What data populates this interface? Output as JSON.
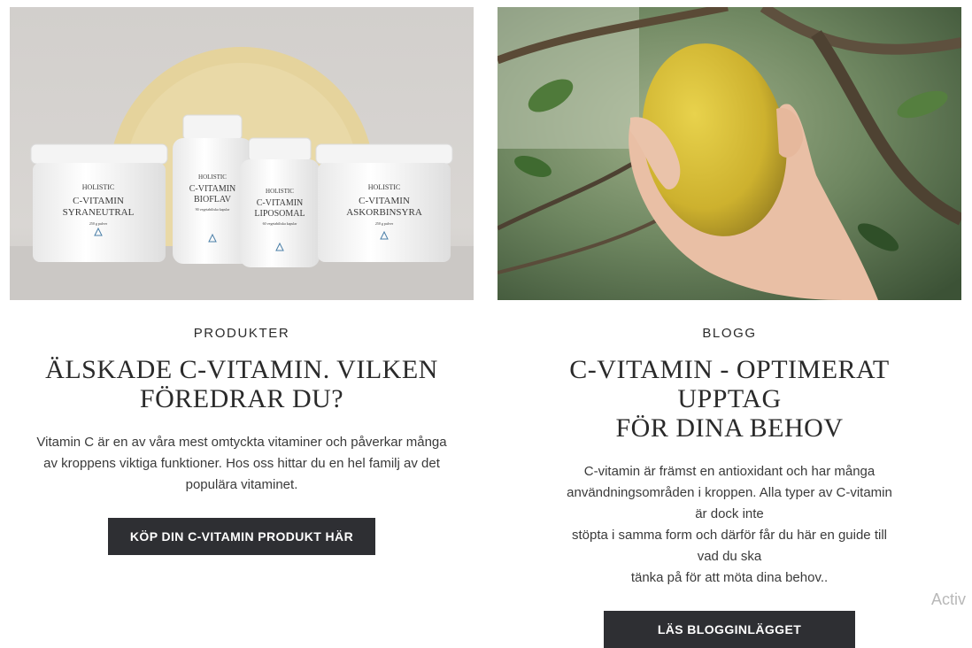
{
  "products_card": {
    "image": {
      "alt_icon": "vitamin-c-products-image",
      "jars": [
        {
          "brand": "HOLISTIC",
          "line1": "C-VITAMIN",
          "line2": "SYRANEUTRAL",
          "sub": "250 g pulver"
        },
        {
          "brand": "HOLISTIC",
          "line1": "C-VITAMIN",
          "line2": "BIOFLAV",
          "sub": "90 vegetabiliska kapslar"
        },
        {
          "brand": "HOLISTIC",
          "line1": "C-VITAMIN",
          "line2": "LIPOSOMAL",
          "sub": "60 vegetabiliska kapslar"
        },
        {
          "brand": "HOLISTIC",
          "line1": "C-VITAMIN",
          "line2": "ASKORBINSYRA",
          "sub": "250 g pulver"
        }
      ]
    },
    "eyebrow": "PRODUKTER",
    "title_line1": "ÄLSKADE C-VITAMIN. VILKEN",
    "title_line2": "FÖREDRAR DU?",
    "body_line1": "Vitamin C är en av våra mest omtyckta vitaminer och påverkar många",
    "body_line2": "av kroppens viktiga funktioner. Hos oss hittar du en hel familj av det",
    "body_line3": "populära vitaminet.",
    "button_label": "KÖP DIN C-VITAMIN PRODUKT HÄR"
  },
  "blog_card": {
    "image": {
      "alt_icon": "lemon-tree-image"
    },
    "eyebrow": "BLOGG",
    "title_line1": "C-VITAMIN - OPTIMERAT UPPTAG",
    "title_line2": "FÖR DINA BEHOV",
    "body_line1": "C-vitamin är främst en antioxidant och har många",
    "body_line2": "användningsområden i kroppen. Alla typer av C-vitamin är dock inte",
    "body_line3": "stöpta i samma form och därför får du här en guide till vad du ska",
    "body_line4": "tänka på för att möta dina behov..",
    "button_label": "LÄS BLOGGINLÄGGET"
  },
  "overlay": {
    "activate_text": "Activ"
  },
  "colors": {
    "button_bg": "#2e2f33",
    "text": "#2a2a2a",
    "photo_bg": "#d6d3d0",
    "disc": "#e5d39c"
  }
}
